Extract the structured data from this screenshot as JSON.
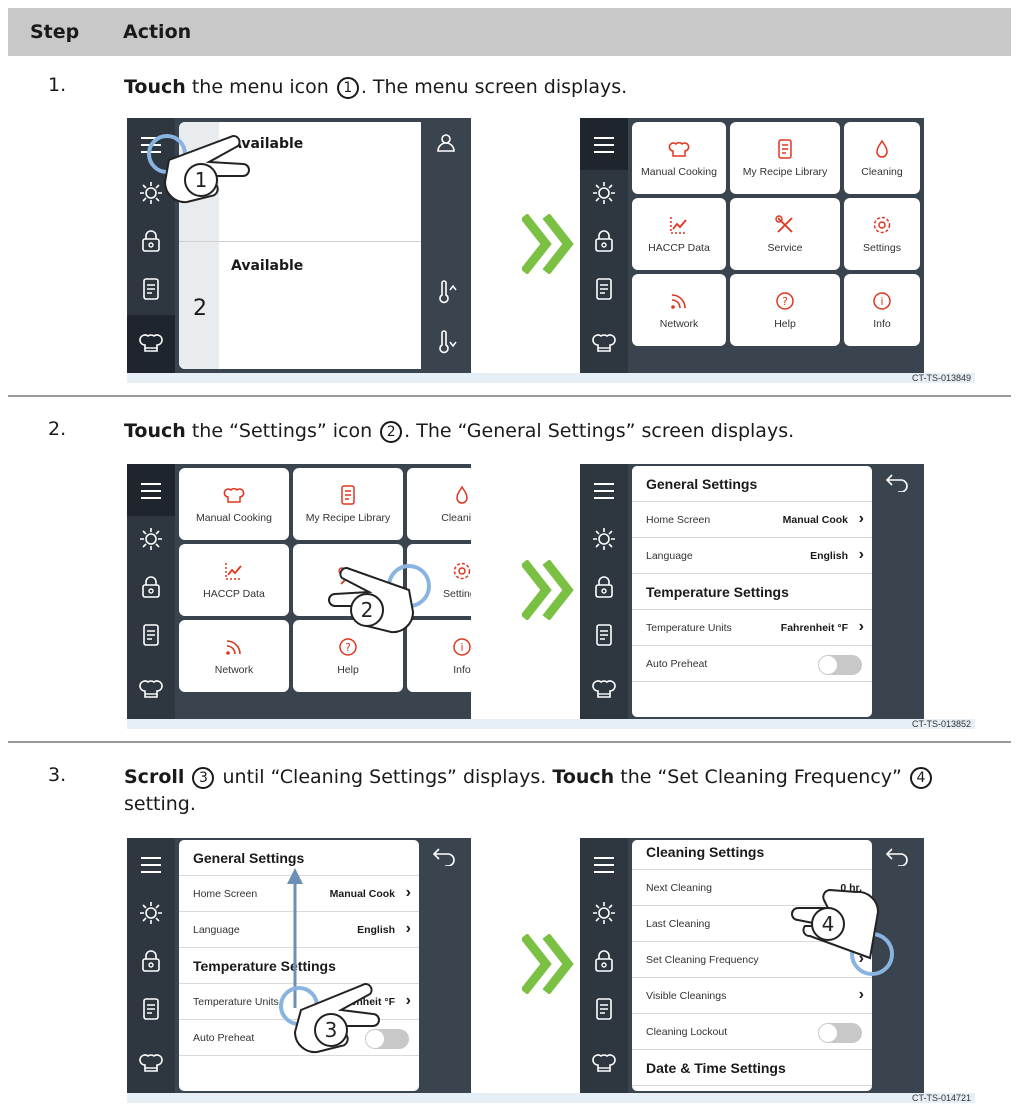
{
  "table": {
    "header_step": "Step",
    "header_action": "Action"
  },
  "steps": [
    {
      "num": "1.",
      "verb": "Touch",
      "text_a": " the menu icon ",
      "circ": "1",
      "text_b": ". The menu screen displays.",
      "figure_code": "CT-TS-013849"
    },
    {
      "num": "2.",
      "verb": "Touch",
      "text_a": " the “Settings” icon ",
      "circ": "2",
      "text_b": ". The “General Settings” screen displays.",
      "figure_code": "CT-TS-013852"
    },
    {
      "num": "3.",
      "verb": "Scroll",
      "circ": "3",
      "text_a": " until “Cleaning Settings” displays. ",
      "verb2": "Touch",
      "text_b": " the “Set Cleaning Frequency” ",
      "circ2": "4",
      "text_c": " setting.",
      "figure_code": "CT-TS-014721"
    }
  ],
  "home_screen": {
    "slot1_status": "Available",
    "slot2_status": "Available",
    "slot2_number": "2"
  },
  "menu_tiles": [
    "Manual Cooking",
    "My Recipe Library",
    "Cleaning",
    "HACCP Data",
    "Service",
    "Settings",
    "Network",
    "Help",
    "Info"
  ],
  "general_settings": {
    "title": "General Settings",
    "home_screen_label": "Home Screen",
    "home_screen_value": "Manual Cook",
    "language_label": "Language",
    "language_value": "English",
    "temp_title": "Temperature Settings",
    "temp_units_label": "Temperature Units",
    "temp_units_value": "Fahrenheit °F",
    "auto_preheat_label": "Auto Preheat"
  },
  "cleaning_settings": {
    "title": "Cleaning Settings",
    "next_label": "Next Cleaning",
    "next_value": "0 hr.",
    "last_label": "Last Cleaning",
    "last_value": "---",
    "freq_label": "Set Cleaning Frequency",
    "visible_label": "Visible Cleanings",
    "lockout_label": "Cleaning Lockout",
    "datetime_title": "Date & Time Settings"
  },
  "colors": {
    "icon_red": "#e0351e",
    "arrow_green": "#7ac043",
    "sidebar": "#2e3740"
  }
}
